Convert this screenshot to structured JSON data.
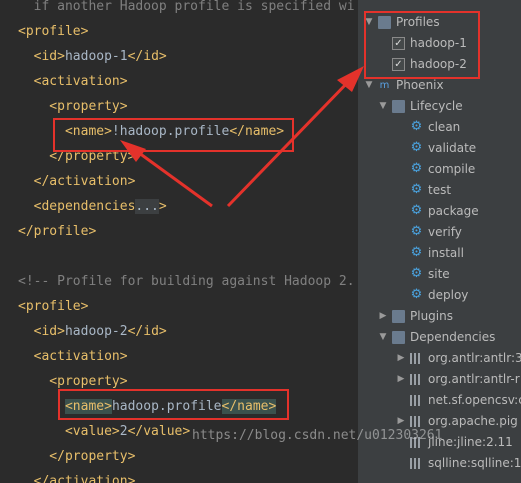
{
  "editor": {
    "lines": [
      {
        "parts": [
          {
            "t": "  if another Hadoop profile is specified wi",
            "c": "comment"
          }
        ]
      },
      {
        "parts": [
          {
            "t": "<profile>",
            "c": ""
          }
        ]
      },
      {
        "parts": [
          {
            "t": "  <id>",
            "c": ""
          },
          {
            "t": "hadoop-1",
            "c": "txt"
          },
          {
            "t": "</id>",
            "c": ""
          }
        ]
      },
      {
        "parts": [
          {
            "t": "  <activation>",
            "c": ""
          }
        ]
      },
      {
        "parts": [
          {
            "t": "    <property>",
            "c": ""
          }
        ]
      },
      {
        "parts": [
          {
            "t": "      <name>",
            "c": ""
          },
          {
            "t": "!hadoop.profile",
            "c": "txt"
          },
          {
            "t": "</name>",
            "c": ""
          }
        ]
      },
      {
        "parts": [
          {
            "t": "    </property>",
            "c": ""
          }
        ]
      },
      {
        "parts": [
          {
            "t": "  </activation>",
            "c": ""
          }
        ]
      },
      {
        "parts": [
          {
            "t": "  <dependencies",
            "c": ""
          },
          {
            "t": "...",
            "c": "fold"
          },
          {
            "t": ">",
            "c": ""
          }
        ]
      },
      {
        "parts": [
          {
            "t": "</profile>",
            "c": ""
          }
        ]
      },
      {
        "parts": [
          {
            "t": "",
            "c": ""
          }
        ]
      },
      {
        "parts": [
          {
            "t": "<!-- Profile for building against Hadoop 2.",
            "c": "comment"
          }
        ]
      },
      {
        "parts": [
          {
            "t": "<profile>",
            "c": ""
          }
        ]
      },
      {
        "parts": [
          {
            "t": "  <id>",
            "c": ""
          },
          {
            "t": "hadoop-2",
            "c": "txt"
          },
          {
            "t": "</id>",
            "c": ""
          }
        ]
      },
      {
        "parts": [
          {
            "t": "  <activation>",
            "c": ""
          }
        ]
      },
      {
        "parts": [
          {
            "t": "    <property>",
            "c": ""
          }
        ]
      },
      {
        "parts": [
          {
            "t": "      ",
            "c": ""
          },
          {
            "t": "<name>",
            "c": "hl"
          },
          {
            "t": "hadoop.profile",
            "c": "txt"
          },
          {
            "t": "</name>",
            "c": "hl"
          }
        ]
      },
      {
        "parts": [
          {
            "t": "      <value>",
            "c": ""
          },
          {
            "t": "2",
            "c": "txt"
          },
          {
            "t": "</value>",
            "c": ""
          }
        ]
      },
      {
        "parts": [
          {
            "t": "    </property>",
            "c": ""
          }
        ]
      },
      {
        "parts": [
          {
            "t": "  </activation>",
            "c": ""
          }
        ]
      }
    ]
  },
  "maven_panel": {
    "rows": [
      {
        "level": 0,
        "arrow": "down",
        "icon": "folder",
        "label": "Profiles"
      },
      {
        "level": 1,
        "arrow": "",
        "icon": "checkbox",
        "label": "hadoop-1",
        "checked": true
      },
      {
        "level": 1,
        "arrow": "",
        "icon": "checkbox",
        "label": "hadoop-2",
        "checked": true
      },
      {
        "level": 0,
        "arrow": "down",
        "icon": "maven",
        "label": "Phoenix"
      },
      {
        "level": 1,
        "arrow": "down",
        "icon": "folder",
        "label": "Lifecycle"
      },
      {
        "level": 2,
        "arrow": "",
        "icon": "gear",
        "label": "clean"
      },
      {
        "level": 2,
        "arrow": "",
        "icon": "gear",
        "label": "validate"
      },
      {
        "level": 2,
        "arrow": "",
        "icon": "gear",
        "label": "compile"
      },
      {
        "level": 2,
        "arrow": "",
        "icon": "gear",
        "label": "test"
      },
      {
        "level": 2,
        "arrow": "",
        "icon": "gear",
        "label": "package"
      },
      {
        "level": 2,
        "arrow": "",
        "icon": "gear",
        "label": "verify"
      },
      {
        "level": 2,
        "arrow": "",
        "icon": "gear",
        "label": "install"
      },
      {
        "level": 2,
        "arrow": "",
        "icon": "gear",
        "label": "site"
      },
      {
        "level": 2,
        "arrow": "",
        "icon": "gear",
        "label": "deploy"
      },
      {
        "level": 1,
        "arrow": "right",
        "icon": "folder",
        "label": "Plugins"
      },
      {
        "level": 1,
        "arrow": "down",
        "icon": "folder",
        "label": "Dependencies"
      },
      {
        "level": 2,
        "arrow": "right",
        "icon": "bars",
        "label": "org.antlr:antlr:3"
      },
      {
        "level": 2,
        "arrow": "right",
        "icon": "bars",
        "label": "org.antlr:antlr-r"
      },
      {
        "level": 2,
        "arrow": "",
        "icon": "bars",
        "label": "net.sf.opencsv:c"
      },
      {
        "level": 2,
        "arrow": "right",
        "icon": "bars",
        "label": "org.apache.pig"
      },
      {
        "level": 2,
        "arrow": "",
        "icon": "bars",
        "label": "jline:jline:2.11"
      },
      {
        "level": 2,
        "arrow": "",
        "icon": "bars",
        "label": "sqlline:sqlline:1"
      }
    ]
  },
  "colors": {
    "annotation": "#e4322b",
    "tag": "#e8bf6a",
    "text": "#a9b7c6",
    "comment": "#808080"
  },
  "watermark": "https://blog.csdn.net/u012303261"
}
